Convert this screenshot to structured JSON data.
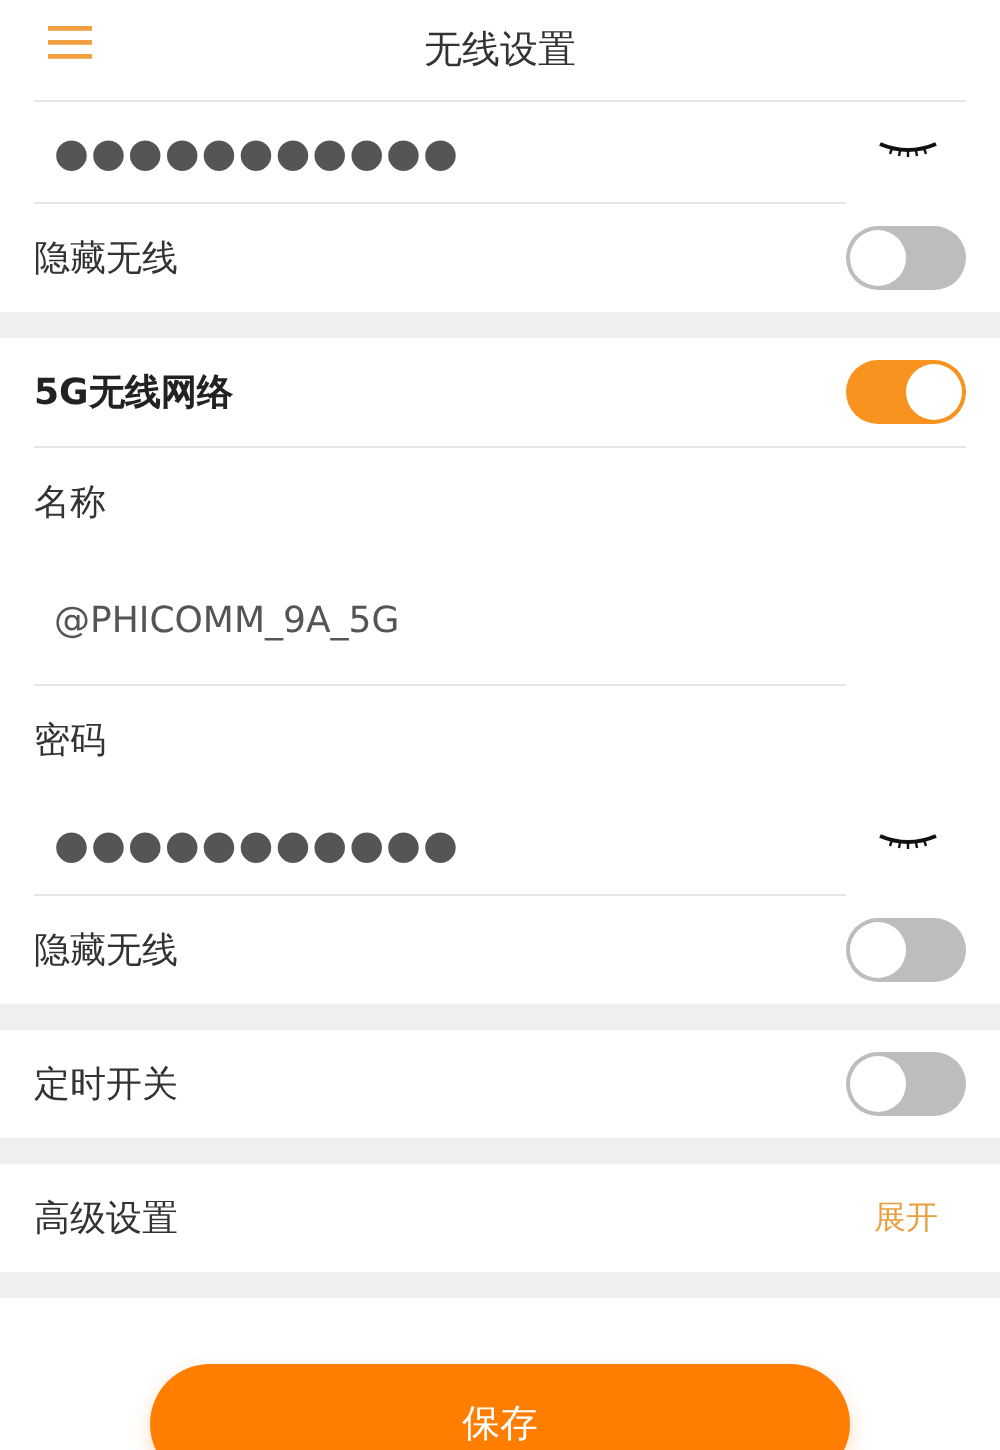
{
  "header": {
    "title": "无线设置"
  },
  "sections": [
    {
      "items": [
        {
          "kind": "password",
          "value": "●●●●●●●●●●●"
        },
        {
          "kind": "toggle",
          "label": "隐藏无线",
          "on": false
        }
      ]
    },
    {
      "items": [
        {
          "kind": "heading-toggle",
          "label": "5G无线网络",
          "on": true
        },
        {
          "kind": "label",
          "label": "名称"
        },
        {
          "kind": "text",
          "value": "@PHICOMM_9A_5G"
        },
        {
          "kind": "label",
          "label": "密码"
        },
        {
          "kind": "password",
          "value": "●●●●●●●●●●●"
        },
        {
          "kind": "toggle",
          "label": "隐藏无线",
          "on": false
        }
      ]
    },
    {
      "items": [
        {
          "kind": "toggle",
          "label": "定时开关",
          "on": false
        }
      ]
    },
    {
      "items": [
        {
          "kind": "expand",
          "label": "高级设置",
          "action": "展开"
        }
      ]
    }
  ],
  "save_button": "保存"
}
